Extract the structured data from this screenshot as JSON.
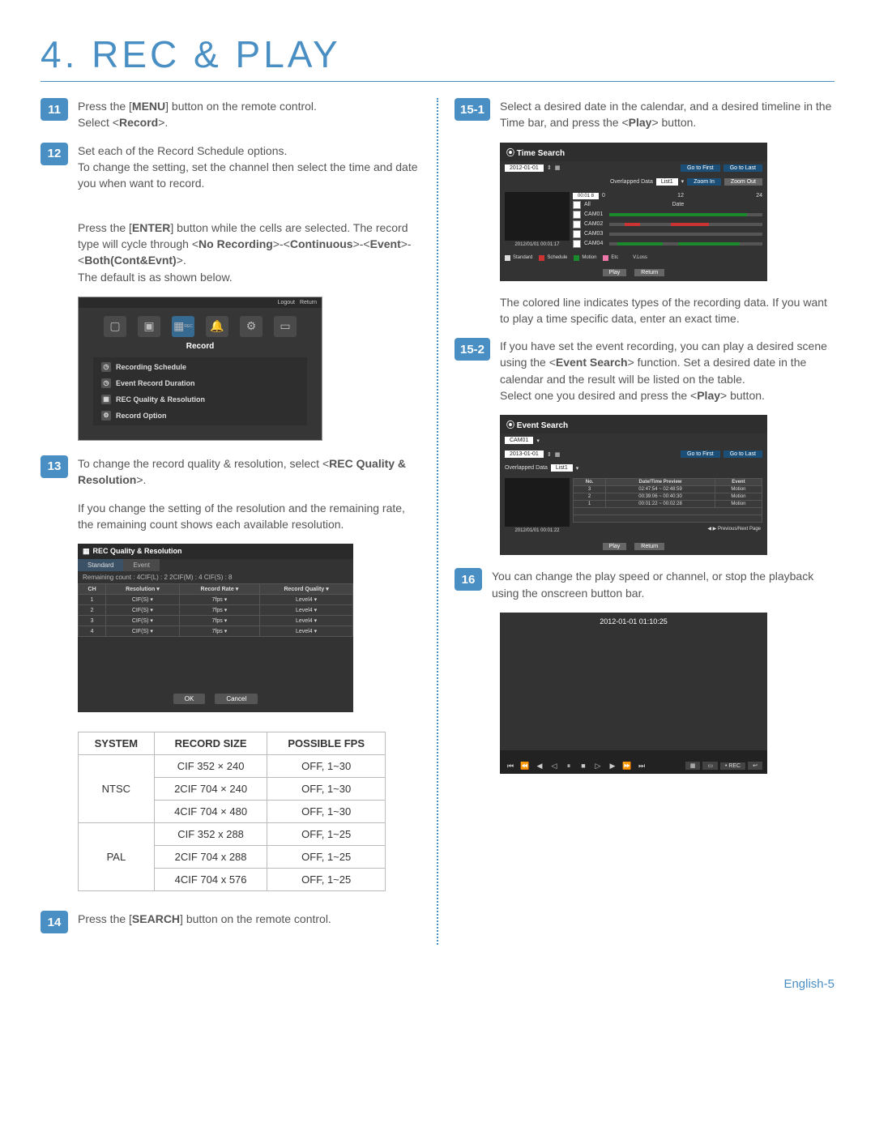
{
  "page_title": "4. REC & PLAY",
  "footer": "English-5",
  "left": {
    "s11": {
      "num": "11",
      "line1": "Press the [",
      "bold1": "MENU",
      "line2": "] button on the remote control.",
      "line3": "Select <",
      "bold2": "Record",
      "line4": ">."
    },
    "s12": {
      "num": "12",
      "para": "Set each of the Record Schedule options.\nTo change the setting, set the channel then select the time and date you when want to record.",
      "p2a": "Press the [",
      "p2bold1": "ENTER",
      "p2b": "] button while the cells are selected. The record type will cycle through <",
      "p2bold2": "No Recording",
      "p2c": ">-<",
      "p2bold3": "Continuous",
      "p2d": ">-<",
      "p2bold4": "Event",
      "p2e": ">-<",
      "p2bold5": "Both(Cont&Evnt)",
      "p2f": ">.\nThe default is as shown below."
    },
    "dvr_topbar": {
      "logout": "Logout",
      "return": "Return"
    },
    "dvr_title": "Record",
    "dvr_menu": [
      "Recording Schedule",
      "Event Record Duration",
      "REC Quality & Resolution",
      "Record Option"
    ],
    "s13": {
      "num": "13",
      "p1a": "To change the record quality & resolution, select <",
      "p1bold": "REC Quality & Resolution",
      "p1b": ">.",
      "p2": "If you change the setting of the resolution and the remaining rate, the remaining count shows each available resolution."
    },
    "rec_panel": {
      "title": "REC Quality & Resolution",
      "tab1": "Standard",
      "tab2": "Event",
      "counts": "Remaining count : 4CIF(L) : 2        2CIF(M) : 4        CIF(S) : 8",
      "headers": [
        "CH",
        "Resolution ▾",
        "Record Rate ▾",
        "Record Quality ▾"
      ],
      "rows": [
        [
          "1",
          "CIF(S)",
          "7fps",
          "Level4"
        ],
        [
          "2",
          "CIF(S)",
          "7fps",
          "Level4"
        ],
        [
          "3",
          "CIF(S)",
          "7fps",
          "Level4"
        ],
        [
          "4",
          "CIF(S)",
          "7fps",
          "Level4"
        ]
      ],
      "ok": "OK",
      "cancel": "Cancel"
    },
    "fps_table": {
      "headers": [
        "SYSTEM",
        "RECORD SIZE",
        "POSSIBLE FPS"
      ],
      "ntsc": "NTSC",
      "pal": "PAL",
      "rows_ntsc": [
        [
          "CIF 352 × 240",
          "OFF, 1~30"
        ],
        [
          "2CIF 704 × 240",
          "OFF, 1~30"
        ],
        [
          "4CIF 704 × 480",
          "OFF, 1~30"
        ]
      ],
      "rows_pal": [
        [
          "CIF 352 x 288",
          "OFF, 1~25"
        ],
        [
          "2CIF 704 x 288",
          "OFF, 1~25"
        ],
        [
          "4CIF 704 x 576",
          "OFF, 1~25"
        ]
      ]
    },
    "s14": {
      "num": "14",
      "a": "Press the [",
      "bold": "SEARCH",
      "b": "] button on the remote control."
    }
  },
  "right": {
    "s15_1": {
      "num": "15-1",
      "a": "Select a desired date in the calendar, and a desired timeline in the Time bar, and press the <",
      "bold": "Play",
      "b": "> button."
    },
    "time_search": {
      "title": "Time Search",
      "date": "2012-01-01",
      "go_first": "Go to First",
      "go_last": "Go to Last",
      "overlapped": "Overlapped Data",
      "list": "List1",
      "zoom_in": "Zoom In",
      "zoom_out": "Zoom Out",
      "time": "00:01  8",
      "tick0": "0",
      "tick12": "12",
      "tick24": "24",
      "all": "All",
      "date_label": "Date",
      "cams": [
        "CAM01",
        "CAM02",
        "CAM03",
        "CAM04"
      ],
      "ts_thumb_label": "2012/01/01 00:01:17",
      "legend": {
        "standard": "Standard",
        "schedule": "Schedule",
        "motion": "Motion",
        "etc": "Etc",
        "vloss": "V.Loss"
      },
      "play": "Play",
      "return": "Return"
    },
    "after_ts": "The colored line indicates types of the recording data. If you want to play a time specific data, enter an exact time.",
    "s15_2": {
      "num": "15-2",
      "a": "If you have set the event recording, you can play a desired scene using the <",
      "bold": "Event Search",
      "b": "> function. Set a desired date in the calendar and the result will be listed on the table.",
      "c": "Select one you desired and press the <",
      "bold2": "Play",
      "d": "> button."
    },
    "event_search": {
      "title": "Event Search",
      "cam": "CAM01",
      "date": "2013-01-01",
      "overlapped": "Overlapped Data",
      "list": "List1",
      "go_first": "Go to First",
      "go_last": "Go to Last",
      "headers": [
        "No.",
        "Date/Time Preview",
        "Event"
      ],
      "rows": [
        [
          "3",
          "02:47:54 ~ 02:48:59",
          "Motion"
        ],
        [
          "2",
          "00:39:06 ~ 00:40:30",
          "Motion"
        ],
        [
          "1",
          "00:01:22 ~ 00:02:28",
          "Motion"
        ]
      ],
      "thumb_label": "2012/01/01 00:01:22",
      "prev_next": "Previous/Next Page",
      "play": "Play",
      "return": "Return"
    },
    "s16": {
      "num": "16",
      "text": "You can change the play speed or channel, or stop the playback using the onscreen button bar."
    },
    "playback": {
      "time": "2012-01-01 01:10:25",
      "rec": "• REC"
    }
  }
}
